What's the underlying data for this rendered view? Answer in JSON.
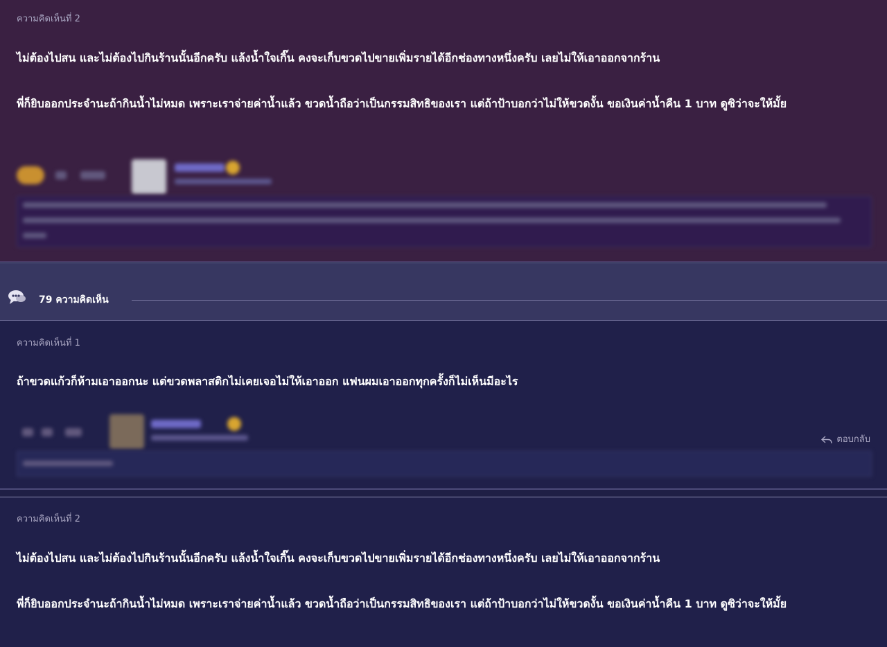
{
  "count_bar": {
    "count_label": "79 ความคิดเห็น"
  },
  "comments": [
    {
      "label": "ความคิดเห็นที่ 2",
      "paragraphs": [
        "ไม่ต้องไปสน และไม่ต้องไปกินร้านนั้นอีกครับ แล้งน้ำใจเกิ๊น   คงจะเก็บขวดไปขายเพิ่มรายได้อีกช่องทางหนึ่งครับ เลยไม่ให้เอาออกจากร้าน",
        "พี่ก็ยิบออกประจำนะถ้ากินน้ำไม่หมด เพราะเราจ่ายค่าน้ำแล้ว ขวดน้ำถือว่าเป็นกรรมสิทธิของเรา  แต่ถ้าป้าบอกว่าไม่ให้ขวดงั้น ขอเงินค่าน้ำคืน 1 บาท ดูซิว่าจะให้มั้ย"
      ]
    },
    {
      "label": "ความคิดเห็นที่ 1",
      "paragraphs": [
        "ถ้าขวดแก้วก็ห้ามเอาออกนะ แต่ขวดพลาสติกไม่เคยเจอไม่ให้เอาออก แฟนผมเอาออกทุกครั้งก็ไม่เห็นมีอะไร"
      ],
      "reply_label": "ตอบกลับ"
    },
    {
      "label": "ความคิดเห็นที่ 2",
      "paragraphs": [
        "ไม่ต้องไปสน และไม่ต้องไปกินร้านนั้นอีกครับ แล้งน้ำใจเกิ๊น   คงจะเก็บขวดไปขายเพิ่มรายได้อีกช่องทางหนึ่งครับ เลยไม่ให้เอาออกจากร้าน",
        "พี่ก็ยิบออกประจำนะถ้ากินน้ำไม่หมด เพราะเราจ่ายค่าน้ำแล้ว ขวดน้ำถือว่าเป็นกรรมสิทธิของเรา  แต่ถ้าป้าบอกว่าไม่ให้ขวดงั้น ขอเงินค่าน้ำคืน 1 บาท ดูซิว่าจะให้มั้ย"
      ]
    }
  ],
  "colors": {
    "featured_bg": "#3a2042",
    "normal_bg": "#20204a",
    "count_bar_bg": "#373761",
    "label_text": "#a9a6c2",
    "body_text": "#ffffff"
  },
  "icons": {
    "count": "speech-bubble-icon",
    "reply": "reply-arrow-icon",
    "reaction": "emoji-reaction-icon"
  }
}
